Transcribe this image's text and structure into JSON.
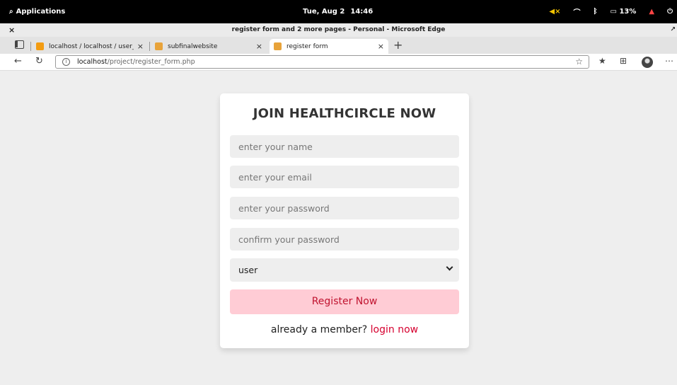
{
  "system_bar": {
    "applications_label": "Applications",
    "date": "Tue, Aug 2",
    "time": "14:46",
    "battery": "13%"
  },
  "window": {
    "title": "register form and 2 more pages - Personal - Microsoft Edge"
  },
  "tabs": [
    {
      "label": "localhost / localhost / user_db /",
      "favicon_color": "#f39c12"
    },
    {
      "label": "subfinalwebsite",
      "favicon_color": "#e8a33a"
    },
    {
      "label": "register form",
      "favicon_color": "#e8a33a"
    }
  ],
  "address_bar": {
    "host": "localhost",
    "path": "/project/register_form.php"
  },
  "form": {
    "title": "JOIN HEALTHCIRCLE NOW",
    "name_placeholder": "enter your name",
    "email_placeholder": "enter your email",
    "password_placeholder": "enter your password",
    "confirm_placeholder": "confirm your password",
    "user_type_selected": "user",
    "submit_label": "Register Now",
    "footer_text": "already a member?",
    "login_link": "login now"
  },
  "colors": {
    "button_bg": "#ffccd5",
    "button_text": "#c0132f",
    "link": "#d6002f",
    "page_bg": "#eeeeee"
  }
}
